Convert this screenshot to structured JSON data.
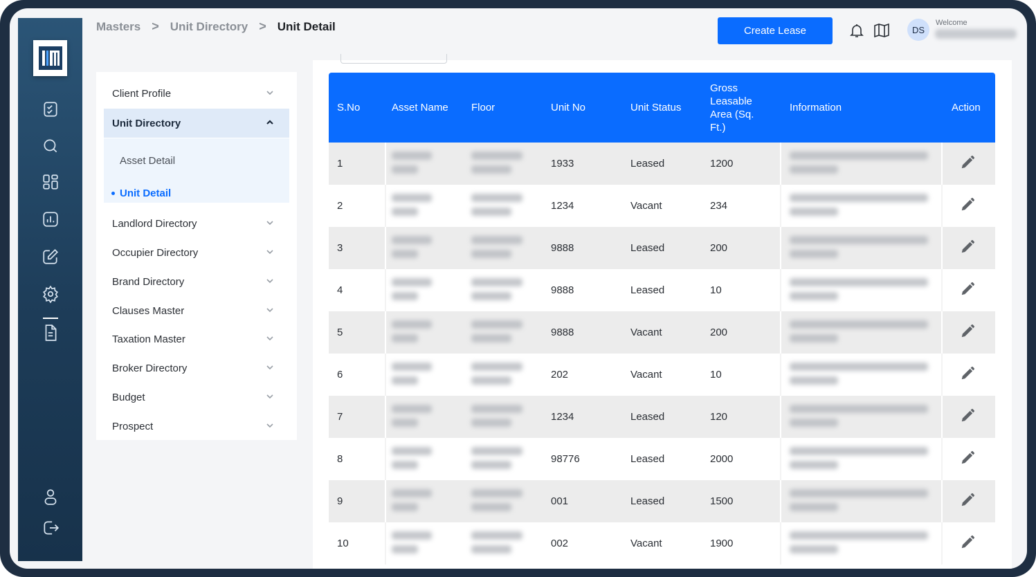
{
  "app": {
    "logo_text": "LM",
    "brand_color": "#0a6cff"
  },
  "rail": {
    "items": [
      {
        "name": "tasks",
        "icon": "checklist-icon"
      },
      {
        "name": "search",
        "icon": "search-icon"
      },
      {
        "name": "dashboard",
        "icon": "grid-icon"
      },
      {
        "name": "reports",
        "icon": "bar-chart-icon"
      },
      {
        "name": "edit",
        "icon": "edit-icon"
      },
      {
        "name": "settings",
        "icon": "gear-icon",
        "active": true
      },
      {
        "name": "documents",
        "icon": "document-icon"
      },
      {
        "name": "profile",
        "icon": "user-icon"
      },
      {
        "name": "logout",
        "icon": "logout-icon"
      }
    ]
  },
  "breadcrumb": {
    "items": [
      "Masters",
      "Unit Directory",
      "Unit Detail"
    ],
    "separator": ">"
  },
  "header": {
    "create_lease_label": "Create Lease",
    "avatar_initials": "DS",
    "welcome_label": "Welcome",
    "notification_icon": "bell-icon",
    "guide_icon": "book-icon"
  },
  "side_menu": {
    "items": [
      {
        "label": "Client Profile",
        "expanded": false
      },
      {
        "label": "Unit Directory",
        "expanded": true,
        "children": [
          {
            "label": "Asset Detail",
            "active": false
          },
          {
            "label": "Unit Detail",
            "active": true
          }
        ]
      },
      {
        "label": "Landlord Directory",
        "expanded": false
      },
      {
        "label": "Occupier Directory",
        "expanded": false
      },
      {
        "label": "Brand Directory",
        "expanded": false
      },
      {
        "label": "Clauses Master",
        "expanded": false
      },
      {
        "label": "Taxation Master",
        "expanded": false
      },
      {
        "label": "Broker Directory",
        "expanded": false
      },
      {
        "label": "Budget",
        "expanded": false
      },
      {
        "label": "Prospect",
        "expanded": false
      }
    ]
  },
  "table": {
    "columns": [
      "S.No",
      "Asset Name",
      "Floor",
      "Unit No",
      "Unit Status",
      "Gross Leasable Area (Sq. Ft.)",
      "Information",
      "Action"
    ],
    "rows": [
      {
        "sno": "1",
        "unit_no": "1933",
        "status": "Leased",
        "area": "1200"
      },
      {
        "sno": "2",
        "unit_no": "1234",
        "status": "Vacant",
        "area": "234"
      },
      {
        "sno": "3",
        "unit_no": "9888",
        "status": "Leased",
        "area": "200"
      },
      {
        "sno": "4",
        "unit_no": "9888",
        "status": "Leased",
        "area": "10"
      },
      {
        "sno": "5",
        "unit_no": "9888",
        "status": "Vacant",
        "area": "200"
      },
      {
        "sno": "6",
        "unit_no": "202",
        "status": "Vacant",
        "area": "10"
      },
      {
        "sno": "7",
        "unit_no": "1234",
        "status": "Leased",
        "area": "120"
      },
      {
        "sno": "8",
        "unit_no": "98776",
        "status": "Leased",
        "area": "2000"
      },
      {
        "sno": "9",
        "unit_no": "001",
        "status": "Leased",
        "area": "1500"
      },
      {
        "sno": "10",
        "unit_no": "002",
        "status": "Vacant",
        "area": "1900"
      }
    ],
    "action_icon": "pencil-icon"
  }
}
